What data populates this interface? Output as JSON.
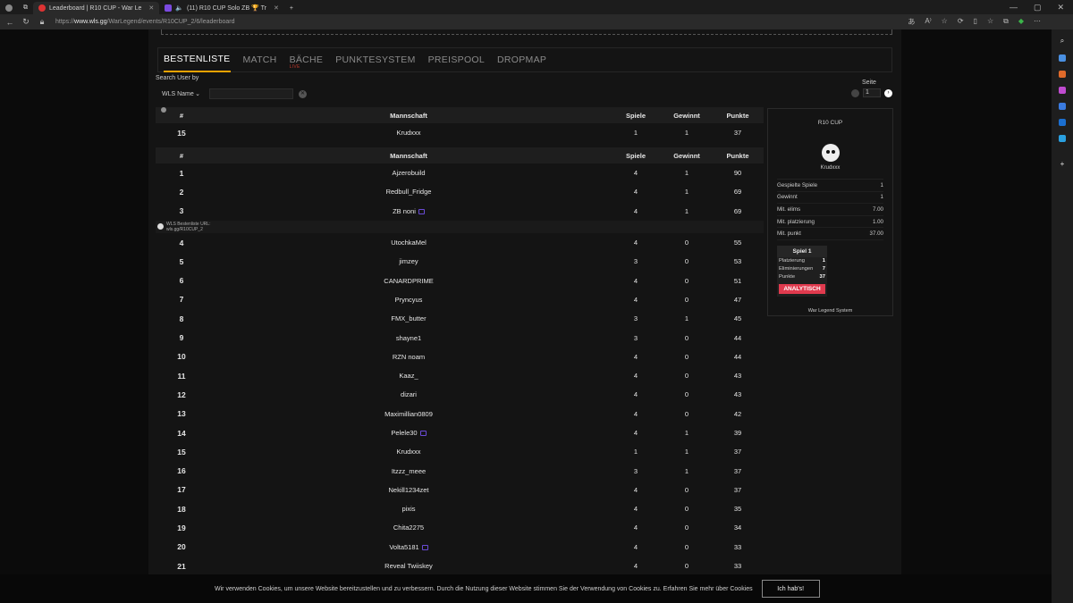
{
  "browser": {
    "tabs": [
      {
        "label": "Leaderboard | R10 CUP - War Le",
        "active": true
      },
      {
        "label": "(11) R10 CUP Solo ZB 🏆 Tr",
        "active": false
      }
    ],
    "url_prefix": "https://",
    "url_host": "www.wls.gg",
    "url_path": "/WarLegend/events/R10CUP_2/6/leaderboard"
  },
  "tabs": [
    {
      "label": "BESTENLISTE",
      "active": true,
      "sub": ""
    },
    {
      "label": "MATCH",
      "active": false,
      "sub": ""
    },
    {
      "label": "BÄCHE",
      "active": false,
      "sub": "LIVE"
    },
    {
      "label": "PUNKTESYSTEM",
      "active": false,
      "sub": ""
    },
    {
      "label": "PREISPOOL",
      "active": false,
      "sub": ""
    },
    {
      "label": "DROPMAP",
      "active": false,
      "sub": ""
    }
  ],
  "search": {
    "label": "Search User by",
    "select_value": "WLS Name",
    "input_value": ""
  },
  "pager": {
    "label": "Seite",
    "value": "1"
  },
  "table_headers": {
    "rank": "#",
    "team": "Mannschaft",
    "games": "Spiele",
    "wins": "Gewinnt",
    "points": "Punkte"
  },
  "my_row": {
    "rank": "15",
    "team": "Krudxxx",
    "games": "1",
    "wins": "1",
    "points": "37"
  },
  "rows_top": [
    {
      "rank": "1",
      "team": "Ajzerobuild",
      "games": "4",
      "wins": "1",
      "points": "90",
      "twitch": false
    },
    {
      "rank": "2",
      "team": "Redbull_Fridge",
      "games": "4",
      "wins": "1",
      "points": "69",
      "twitch": false
    },
    {
      "rank": "3",
      "team": "ZB noni",
      "games": "4",
      "wins": "1",
      "points": "69",
      "twitch": true
    }
  ],
  "sponsor": {
    "line1": "WLS Bestenliste URL:",
    "line2": "wls.gg/R10CUP_2"
  },
  "rows_rest": [
    {
      "rank": "4",
      "team": "UtochkaMel",
      "games": "4",
      "wins": "0",
      "points": "55",
      "twitch": false
    },
    {
      "rank": "5",
      "team": "jimzey",
      "games": "3",
      "wins": "0",
      "points": "53",
      "twitch": false
    },
    {
      "rank": "6",
      "team": "CANARDPRIME",
      "games": "4",
      "wins": "0",
      "points": "51",
      "twitch": false
    },
    {
      "rank": "7",
      "team": "Pryncyus",
      "games": "4",
      "wins": "0",
      "points": "47",
      "twitch": false
    },
    {
      "rank": "8",
      "team": "FMX_butter",
      "games": "3",
      "wins": "1",
      "points": "45",
      "twitch": false
    },
    {
      "rank": "9",
      "team": "shayne1",
      "games": "3",
      "wins": "0",
      "points": "44",
      "twitch": false
    },
    {
      "rank": "10",
      "team": "RZN noam",
      "games": "4",
      "wins": "0",
      "points": "44",
      "twitch": false
    },
    {
      "rank": "11",
      "team": "Kaaz_",
      "games": "4",
      "wins": "0",
      "points": "43",
      "twitch": false
    },
    {
      "rank": "12",
      "team": "dizari",
      "games": "4",
      "wins": "0",
      "points": "43",
      "twitch": false
    },
    {
      "rank": "13",
      "team": "Maximillian0809",
      "games": "4",
      "wins": "0",
      "points": "42",
      "twitch": false
    },
    {
      "rank": "14",
      "team": "Pelele30",
      "games": "4",
      "wins": "1",
      "points": "39",
      "twitch": true
    },
    {
      "rank": "15",
      "team": "Krudxxx",
      "games": "1",
      "wins": "1",
      "points": "37",
      "twitch": false
    },
    {
      "rank": "16",
      "team": "Itzzz_meee",
      "games": "3",
      "wins": "1",
      "points": "37",
      "twitch": false
    },
    {
      "rank": "17",
      "team": "Nekill1234zet",
      "games": "4",
      "wins": "0",
      "points": "37",
      "twitch": false
    },
    {
      "rank": "18",
      "team": "pixis",
      "games": "4",
      "wins": "0",
      "points": "35",
      "twitch": false
    },
    {
      "rank": "19",
      "team": "Chita2275",
      "games": "4",
      "wins": "0",
      "points": "34",
      "twitch": false
    },
    {
      "rank": "20",
      "team": "Volta5181",
      "games": "4",
      "wins": "0",
      "points": "33",
      "twitch": true
    },
    {
      "rank": "21",
      "team": "Reveal Twiiskey",
      "games": "4",
      "wins": "0",
      "points": "33",
      "twitch": false
    }
  ],
  "card": {
    "title": "R10 CUP",
    "name": "Krudxxx",
    "stats": [
      {
        "label": "Gespielte Spiele",
        "value": "1"
      },
      {
        "label": "Gewinnt",
        "value": "1"
      },
      {
        "label": "Mit. elims",
        "value": "7.00"
      },
      {
        "label": "Mit. platzierung",
        "value": "1.00"
      },
      {
        "label": "Mit. punkt",
        "value": "37.00"
      }
    ],
    "game": {
      "title": "Spiel 1",
      "lines": [
        {
          "label": "Platzierung",
          "value": "1"
        },
        {
          "label": "Eliminierungen",
          "value": "7"
        },
        {
          "label": "Punkte",
          "value": "37"
        }
      ],
      "button": "ANALYTISCH"
    },
    "footer": "War Legend System"
  },
  "cookie": {
    "message": "Wir verwenden Cookies, um unsere Website bereitzustellen und zu verbessern. Durch die Nutzung dieser Website stimmen Sie der Verwendung von Cookies zu. Erfahren Sie mehr über Cookies",
    "button": "Ich hab's!"
  },
  "colors": {
    "accent": "#f6a300",
    "live": "#c0392b",
    "analytics": "#e03a4e",
    "twitch": "#6a4bd6"
  }
}
